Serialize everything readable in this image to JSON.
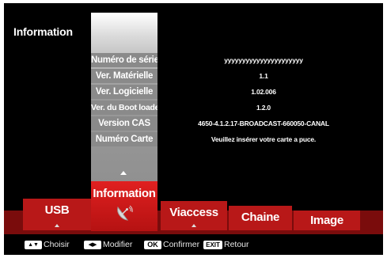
{
  "header": {
    "title": "Information"
  },
  "info_rows": [
    {
      "label": "Numéro de série",
      "value": "yyyyyyyyyyyyyyyyyyyyyy"
    },
    {
      "label": "Ver. Matérielle",
      "value": "1.1"
    },
    {
      "label": "Ver. Logicielle",
      "value": "1.02.006"
    },
    {
      "label": "Ver. du Boot loader",
      "value": "1.2.0"
    },
    {
      "label": "Version CAS",
      "value": "4650-4.1.2.17-BROADCAST-660050-CANAL"
    },
    {
      "label": "Numéro Carte",
      "value": "Veuillez insérer votre carte a puce."
    }
  ],
  "menu": {
    "tabs": [
      {
        "label": "USB"
      },
      {
        "label": "Information"
      },
      {
        "label": "Viaccess"
      },
      {
        "label": "Chaine"
      },
      {
        "label": "Image"
      }
    ],
    "active": "Information"
  },
  "legend": [
    {
      "key": "▲▼",
      "icon": "up-down-arrows-icon",
      "label": "Choisir"
    },
    {
      "key": "◀▶",
      "icon": "left-right-arrows-icon",
      "label": "Modifier"
    },
    {
      "key": "OK",
      "icon": "ok-key-icon",
      "label": "Confirmer"
    },
    {
      "key": "EXIT",
      "icon": "exit-key-icon",
      "label": "Retour"
    }
  ],
  "colors": {
    "background": "#000000",
    "menu_bar": "#7a0c0c",
    "tab": "#b81818",
    "tab_active": "#e02020",
    "label_cell": "#8a8a8a"
  }
}
